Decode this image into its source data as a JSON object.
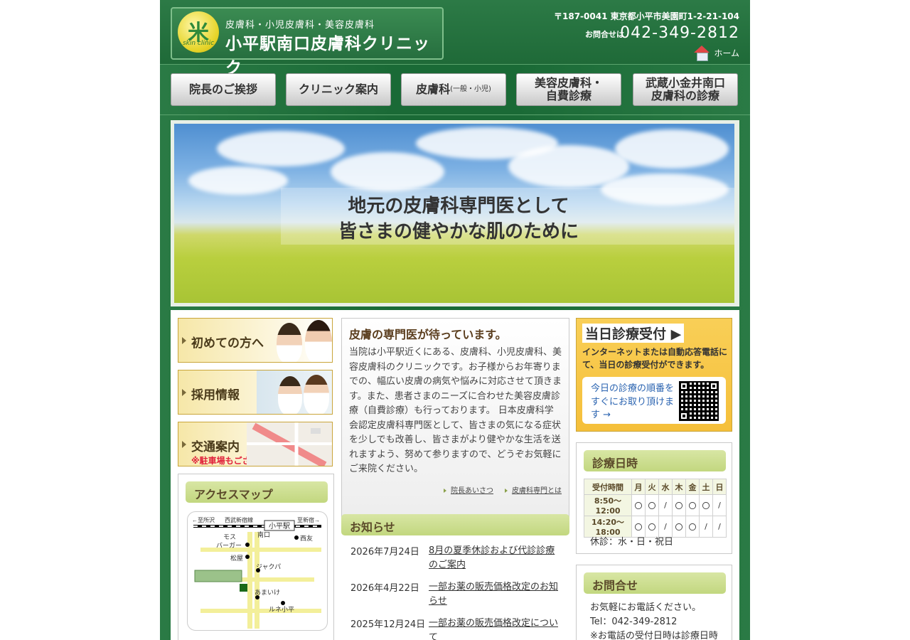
{
  "header": {
    "logo_sub": "皮膚科・小児皮膚科・美容皮膚科",
    "logo_title": "小平駅南口皮膚科クリニック",
    "logo_mark_text": "skin clinic",
    "address": "〒187-0041 東京都小平市美園町1-2-21-104",
    "tel_label": "お問合せは",
    "tel": "042-349-2812",
    "home_label": "ホーム"
  },
  "nav": {
    "items": [
      {
        "label": "院長のご挨拶"
      },
      {
        "label": "クリニック案内"
      },
      {
        "label": "皮膚科",
        "small": "(一般・小児)"
      },
      {
        "label": "美容皮膚科・",
        "label2": "自費診療"
      },
      {
        "label": "武蔵小金井南口",
        "label2": "皮膚科の診療"
      }
    ]
  },
  "hero": {
    "line1": "地元の皮膚科専門医として",
    "line2": "皆さまの健やかな肌のために"
  },
  "left": {
    "banner_first": "初めての方へ",
    "banner_recruit": "採用情報",
    "banner_access": "交通案内",
    "banner_access_note": "※駐車場もございます",
    "access_map_title": "アクセスマップ",
    "map": {
      "station": "小平駅",
      "south_exit": "南口",
      "to_tokorozawa": "←至所沢",
      "line": "西武新宿線",
      "to_shinjuku": "至新宿→",
      "mos": "モス",
      "mos2": "バーガー",
      "matsuya": "松屋",
      "seiyu": "西友",
      "jackpa": "ジャクパ",
      "amaike": "あまいけ",
      "lune": "ルネ小平"
    }
  },
  "center": {
    "intro_title": "皮膚の専門医が待っています。",
    "intro_body": "当院は小平駅近くにある、皮膚科、小児皮膚科、美容皮膚科のクリニックです。お子様からお年寄りまでの、幅広い皮膚の病気や悩みに対応させて頂きます。また、患者さまのニーズに合わせた美容皮膚診療（自費診療）も行っております。 日本皮膚科学会認定皮膚科専門医として、皆さまの気になる症状を少しでも改善し、皆さまがより健やかな生活を送れますよう、努めて参りますので、どうぞお気軽にご来院ください。",
    "link1": "院長あいさつ",
    "link2": "皮膚科専門とは",
    "news_title": "お知らせ",
    "news": [
      {
        "date": "2026年7月24日",
        "title": "8月の夏季休診および代診診療のご案内"
      },
      {
        "date": "2026年4月22日",
        "title": "一部お薬の販売価格改定のお知らせ"
      },
      {
        "date": "2025年12月24日",
        "title": "一部お薬の販売価格改定について"
      }
    ]
  },
  "right": {
    "today_title": "当日診療受付 ▶",
    "today_desc": "インターネットまたは自動応答電話にて、当日の診療受付ができます。",
    "today_card": "今日の診療の順番をすぐにお取り頂けます →",
    "hours_title": "診療日時",
    "hours_header": [
      "受付時間",
      "月",
      "火",
      "水",
      "木",
      "金",
      "土",
      "日"
    ],
    "hours_rows": [
      [
        "8:50～12:00",
        "〇",
        "〇",
        "/",
        "〇",
        "〇",
        "〇",
        "/"
      ],
      [
        "14:20～18:00",
        "〇",
        "〇",
        "/",
        "〇",
        "〇",
        "/",
        "/"
      ]
    ],
    "closed": "休診：水・日・祝日",
    "contact_title": "お問合せ",
    "contact_line1": "お気軽にお電話ください。",
    "contact_line2": "Tel：042-349-2812",
    "contact_line3": "※お電話の受付日時は診療日時"
  }
}
